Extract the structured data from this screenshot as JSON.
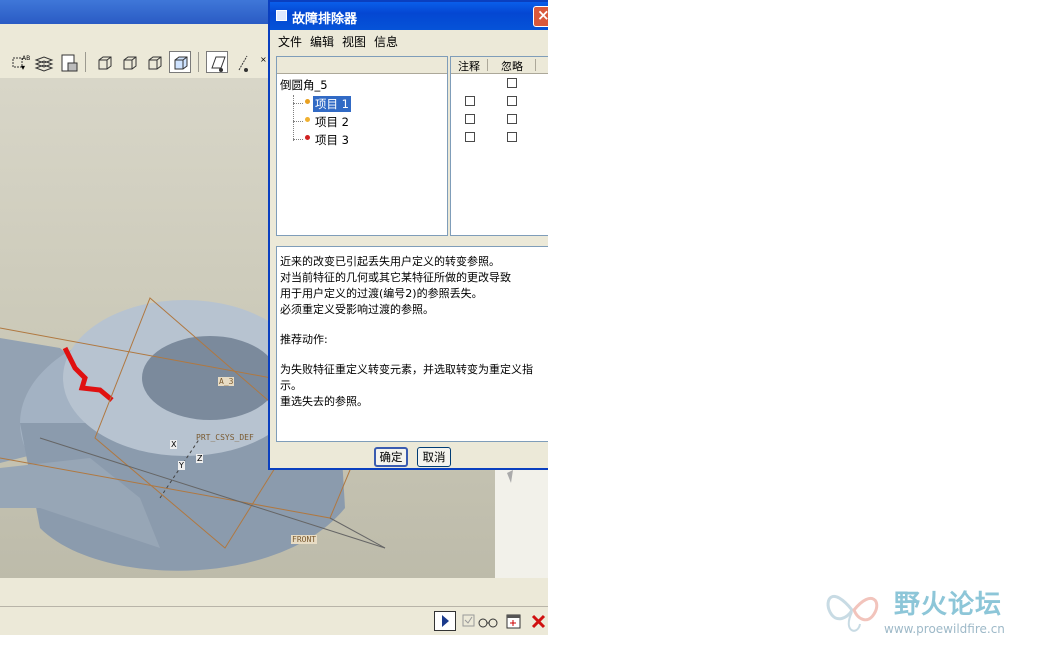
{
  "dialog": {
    "title": "故障排除器",
    "close_glyph": "×",
    "menu": [
      "文件",
      "编辑",
      "视图",
      "信息"
    ],
    "columns": {
      "note": "注释",
      "ignore": "忽略"
    },
    "tree": {
      "root": "倒圆角_5",
      "items": [
        {
          "label": "项目 1",
          "dot_color": "#e8a020",
          "selected": true
        },
        {
          "label": "项目 2",
          "dot_color": "#f0b030",
          "selected": false
        },
        {
          "label": "项目 3",
          "dot_color": "#d02020",
          "selected": false
        }
      ]
    },
    "message_lines": [
      "近来的改变已引起丢失用户定义的转变参照。",
      "对当前特征的几何或其它某特征所做的更改导致",
      "用于用户定义的过渡(编号2)的参照丢失。",
      "必须重定义受影响过渡的参照。",
      "",
      "推荐动作:",
      "",
      "为失败特征重定义转变元素，并选取转变为重定义指",
      "示。",
      "重选失去的参照。"
    ],
    "ok_label": "确定",
    "cancel_label": "取消"
  },
  "viewport": {
    "datum_labels": {
      "a": "A_3",
      "csys": "PRT_CSYS_DEF",
      "front": "FRONT",
      "x": "X",
      "y": "Y",
      "z": "Z"
    },
    "highlight_color": "#e01010",
    "datum_color": "#b07840"
  },
  "watermark": {
    "title": "野火论坛",
    "url": "www.proewildfire.cn"
  }
}
